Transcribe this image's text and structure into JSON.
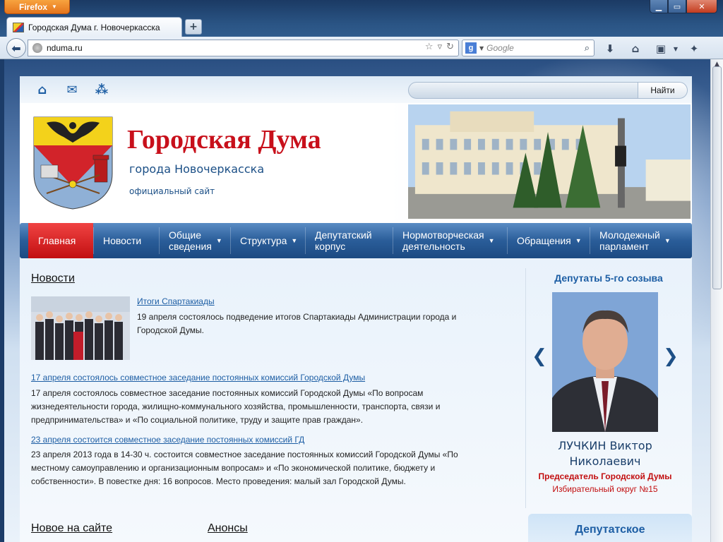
{
  "browser": {
    "menu_label": "Firefox",
    "tab_title": "Городская Дума г. Новочеркасска",
    "url": "nduma.ru",
    "search_engine_letter": "g",
    "search_placeholder": "Google",
    "new_tab_label": "+",
    "icons": [
      "back-arrow-icon",
      "globe-icon",
      "bookmark-star-icon",
      "dropdown-icon",
      "reload-icon",
      "search-icon",
      "download-icon",
      "home-icon",
      "bookmarks-menu-icon",
      "addon-icon"
    ]
  },
  "site": {
    "topbar_icons": [
      "home-icon",
      "mail-icon",
      "sitemap-icon"
    ],
    "search_button": "Найти",
    "title": "Городская Дума",
    "subtitle": "города Новочеркасска",
    "tagline": "официальный сайт",
    "colors": {
      "accent_red": "#c8101b",
      "accent_blue": "#1d5ea4"
    }
  },
  "menu": [
    {
      "label": "Главная",
      "active": true,
      "dropdown": false
    },
    {
      "label": "Новости",
      "active": false,
      "dropdown": false
    },
    {
      "label": "Общие\nсведения",
      "active": false,
      "dropdown": true
    },
    {
      "label": "Структура",
      "active": false,
      "dropdown": true
    },
    {
      "label": "Депутатский\nкорпус",
      "active": false,
      "dropdown": false
    },
    {
      "label": "Нормотворческая\nдеятельность",
      "active": false,
      "dropdown": true
    },
    {
      "label": "Обращения",
      "active": false,
      "dropdown": true
    },
    {
      "label": "Молодежный\nпарламент",
      "active": false,
      "dropdown": true
    }
  ],
  "news": {
    "heading": "Новости",
    "items": [
      {
        "title": "Итоги Спартакиады",
        "text_line1": "19 апреля состоялось подведение итогов Спартакиады Администрации города и",
        "text_line2": "Городской Думы."
      },
      {
        "title": "17 апреля состоялось совместное заседание постоянных комиссий Городской Думы",
        "text_line1": "17 апреля состоялось совместное заседание постоянных комиссий Городской Думы «По вопросам",
        "text_line2": "жизнедеятельности города, жилищно-коммунального хозяйства, промышленности, транспорта, связи и",
        "text_line3": "предпринимательства» и «По социальной политике, труду и защите прав граждан»."
      },
      {
        "title": "23 апреля состоится совместное заседание постоянных комиссий ГД",
        "text_line1": "23 апреля 2013 года в 14-30 ч. состоится совместное заседание постоянных комиссий Городской Думы «По",
        "text_line2": "местному самоуправлению и организационным вопросам» и «По экономической политике, бюджету и",
        "text_line3": "собственности». В повестке дня: 16 вопросов. Место проведения: малый зал Городской Думы."
      }
    ]
  },
  "bottom": {
    "new_heading": "Новое на сайте",
    "announce_heading": "Анонсы"
  },
  "deputies": {
    "heading": "Депутаты 5-го созыва",
    "name_line1": "ЛУЧКИН Виктор",
    "name_line2": "Николаевич",
    "role": "Председатель Городской Думы",
    "district": "Избирательный округ №15",
    "box_title": "Депутатское"
  }
}
